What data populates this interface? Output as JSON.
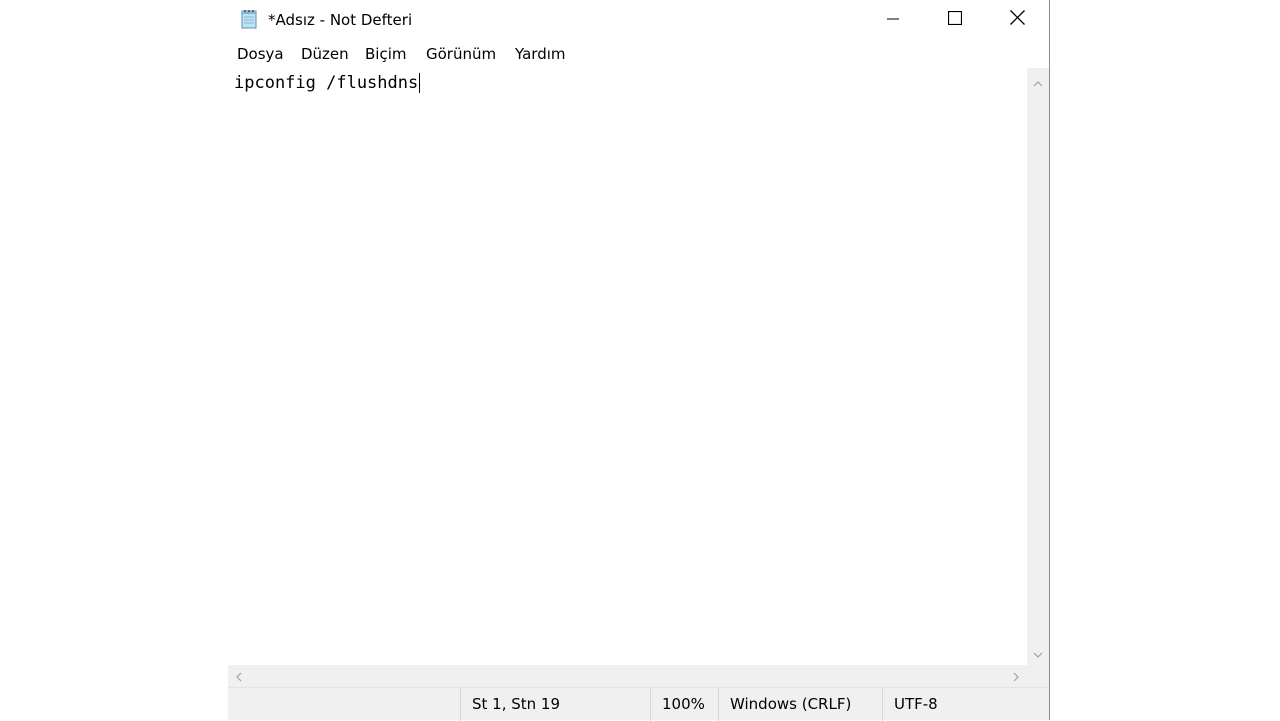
{
  "window": {
    "title": "*Adsız - Not Defteri"
  },
  "menu": {
    "items": [
      "Dosya",
      "Düzen",
      "Biçim",
      "Görünüm",
      "Yardım"
    ]
  },
  "editor": {
    "content": "ipconfig /flushdns"
  },
  "status": {
    "position": "St 1, Stn 19",
    "zoom": "100%",
    "line_ending": "Windows (CRLF)",
    "encoding": "UTF-8"
  },
  "icons": {
    "app": "notepad-icon",
    "minimize": "minimize-icon",
    "maximize": "maximize-icon",
    "close": "close-icon"
  }
}
